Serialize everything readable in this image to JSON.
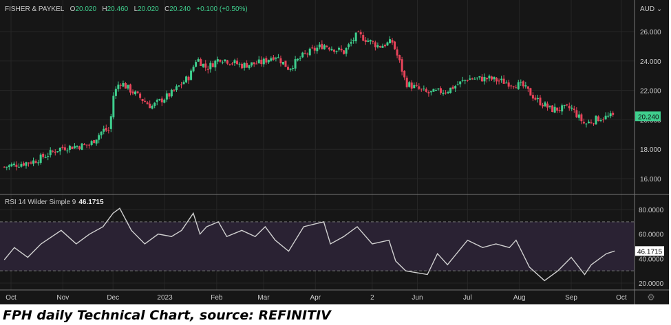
{
  "header": {
    "name": "FISHER & PAYKEL",
    "o_label": "O",
    "open": "20.020",
    "h_label": "H",
    "high": "20.460",
    "l_label": "L",
    "low": "20.020",
    "c_label": "C",
    "close": "20.240",
    "change": "+0.100 (+0.50%)"
  },
  "currency": "AUD",
  "caption": "FPH daily Technical Chart, source: REFINITIV",
  "colors": {
    "up": "#3fcf8e",
    "down": "#e8445a",
    "bg": "#161616",
    "rsi_band": "#2a2233"
  },
  "chart_data": [
    {
      "type": "candlestick",
      "title": "FISHER & PAYKEL",
      "x_unit": "days since 2022-10-01",
      "ylim": [
        15,
        27
      ],
      "y_ticks": [
        "16.000",
        "18.000",
        "20.000",
        "22.000",
        "24.000",
        "26.000"
      ],
      "last_price": "20.240",
      "close_path": [
        [
          -4,
          16.8
        ],
        [
          14,
          17.2
        ],
        [
          30,
          18.1
        ],
        [
          47,
          18.3
        ],
        [
          55,
          19.3
        ],
        [
          59,
          19.3
        ],
        [
          61,
          21.6
        ],
        [
          65,
          22.6
        ],
        [
          76,
          21.6
        ],
        [
          84,
          20.9
        ],
        [
          96,
          21.8
        ],
        [
          107,
          23.0
        ],
        [
          111,
          24.2
        ],
        [
          117,
          23.5
        ],
        [
          125,
          24.2
        ],
        [
          138,
          23.7
        ],
        [
          150,
          23.9
        ],
        [
          158,
          24.4
        ],
        [
          166,
          23.5
        ],
        [
          175,
          24.4
        ],
        [
          187,
          25.1
        ],
        [
          199,
          24.6
        ],
        [
          207,
          25.8
        ],
        [
          220,
          25.0
        ],
        [
          228,
          25.3
        ],
        [
          233,
          23.7
        ],
        [
          236,
          22.5
        ],
        [
          249,
          21.8
        ],
        [
          261,
          22.0
        ],
        [
          273,
          22.8
        ],
        [
          286,
          22.8
        ],
        [
          298,
          22.5
        ],
        [
          306,
          22.3
        ],
        [
          314,
          21.4
        ],
        [
          323,
          20.7
        ],
        [
          335,
          20.8
        ],
        [
          343,
          19.7
        ],
        [
          351,
          20.1
        ],
        [
          360,
          20.24
        ]
      ]
    },
    {
      "type": "line",
      "title": "RSI 14 Wilder Simple 9",
      "last_value": "46.1715",
      "ylim": [
        15,
        85
      ],
      "y_ticks": [
        "20.0000",
        "40.0000",
        "60.0000",
        "80.0000"
      ],
      "bands": [
        30,
        70
      ],
      "points": [
        [
          -4,
          39
        ],
        [
          2,
          49
        ],
        [
          10,
          41
        ],
        [
          18,
          52
        ],
        [
          30,
          63
        ],
        [
          39,
          52
        ],
        [
          47,
          60
        ],
        [
          55,
          66
        ],
        [
          61,
          77
        ],
        [
          65,
          81
        ],
        [
          72,
          63
        ],
        [
          80,
          52
        ],
        [
          88,
          60
        ],
        [
          96,
          58
        ],
        [
          102,
          63
        ],
        [
          109,
          77
        ],
        [
          113,
          60
        ],
        [
          117,
          66
        ],
        [
          124,
          70
        ],
        [
          129,
          58
        ],
        [
          138,
          63
        ],
        [
          146,
          58
        ],
        [
          152,
          66
        ],
        [
          158,
          55
        ],
        [
          166,
          46
        ],
        [
          175,
          66
        ],
        [
          187,
          70
        ],
        [
          191,
          52
        ],
        [
          199,
          58
        ],
        [
          207,
          66
        ],
        [
          216,
          52
        ],
        [
          226,
          55
        ],
        [
          230,
          38
        ],
        [
          236,
          30
        ],
        [
          249,
          27
        ],
        [
          255,
          44
        ],
        [
          261,
          35
        ],
        [
          273,
          55
        ],
        [
          282,
          49
        ],
        [
          290,
          52
        ],
        [
          298,
          49
        ],
        [
          302,
          55
        ],
        [
          310,
          33
        ],
        [
          319,
          22
        ],
        [
          327,
          30
        ],
        [
          335,
          41
        ],
        [
          343,
          27
        ],
        [
          347,
          35
        ],
        [
          356,
          44
        ],
        [
          361,
          46.17
        ]
      ]
    },
    {
      "x_labels": [
        [
          "Oct",
          0
        ],
        [
          "Nov",
          31
        ],
        [
          "Dec",
          61
        ],
        [
          "2023",
          92
        ],
        [
          "Feb",
          123
        ],
        [
          "Mar",
          151
        ],
        [
          "Apr",
          182
        ],
        [
          "2",
          216
        ],
        [
          "Jun",
          243
        ],
        [
          "Jul",
          273
        ],
        [
          "Aug",
          304
        ],
        [
          "Sep",
          335
        ],
        [
          "Oct",
          365
        ]
      ]
    }
  ]
}
